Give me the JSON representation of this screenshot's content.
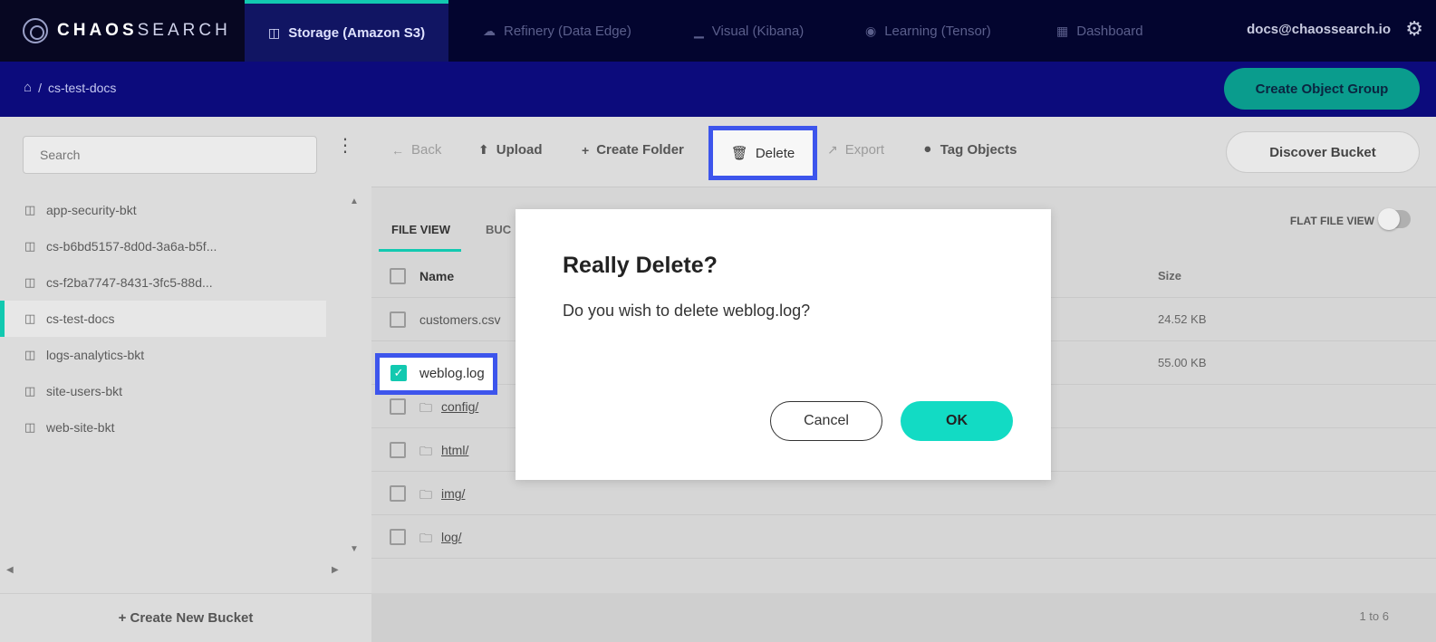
{
  "brand": {
    "name_a": "CHAOS",
    "name_b": "SEARCH"
  },
  "nav": {
    "tabs": [
      {
        "label": "Storage (Amazon S3)",
        "icon": "bucket-icon"
      },
      {
        "label": "Refinery (Data Edge)",
        "icon": "cloud-icon"
      },
      {
        "label": "Visual (Kibana)",
        "icon": "bar-chart-icon"
      },
      {
        "label": "Learning (Tensor)",
        "icon": "globe-icon"
      },
      {
        "label": "Dashboard",
        "icon": "grid-icon"
      }
    ],
    "user": "docs@chaossearch.io"
  },
  "breadcrumb": {
    "sep": "/",
    "current": "cs-test-docs"
  },
  "header": {
    "create_group_label": "Create Object Group"
  },
  "sidebar": {
    "search_placeholder": "Search",
    "buckets": [
      "app-security-bkt",
      "cs-b6bd5157-8d0d-3a6a-b5f...",
      "cs-f2ba7747-8431-3fc5-88d...",
      "cs-test-docs",
      "logs-analytics-bkt",
      "site-users-bkt",
      "web-site-bkt"
    ],
    "active_bucket": "cs-test-docs",
    "create_bucket_label": "+ Create New Bucket"
  },
  "toolbar": {
    "back": "Back",
    "upload": "Upload",
    "create_folder": "Create Folder",
    "delete": "Delete",
    "export": "Export",
    "tag_objects": "Tag Objects",
    "discover_bucket": "Discover Bucket"
  },
  "view": {
    "tabs": [
      "FILE VIEW",
      "BUC"
    ],
    "flat_file_view_label": "FLAT FILE VIEW",
    "flat_file_view_on": false
  },
  "table": {
    "headers": {
      "name": "Name",
      "size": "Size"
    },
    "rows": [
      {
        "name": "customers.csv",
        "size": "24.52 KB",
        "folder": false,
        "checked": false
      },
      {
        "name": "weblog.log",
        "size": "55.00 KB",
        "folder": false,
        "checked": true
      },
      {
        "name": "config/",
        "size": "",
        "folder": true,
        "checked": false
      },
      {
        "name": "html/",
        "size": "",
        "folder": true,
        "checked": false
      },
      {
        "name": "img/",
        "size": "",
        "folder": true,
        "checked": false
      },
      {
        "name": "log/",
        "size": "",
        "folder": true,
        "checked": false
      }
    ],
    "pager": "1 to 6"
  },
  "modal": {
    "title": "Really Delete?",
    "message": "Do you wish to delete weblog.log?",
    "cancel": "Cancel",
    "ok": "OK"
  },
  "colors": {
    "accent": "#12c9b0",
    "highlight": "#3d55ec",
    "nav_bg": "#03052f",
    "crumb_bg": "#0c0b7c"
  }
}
